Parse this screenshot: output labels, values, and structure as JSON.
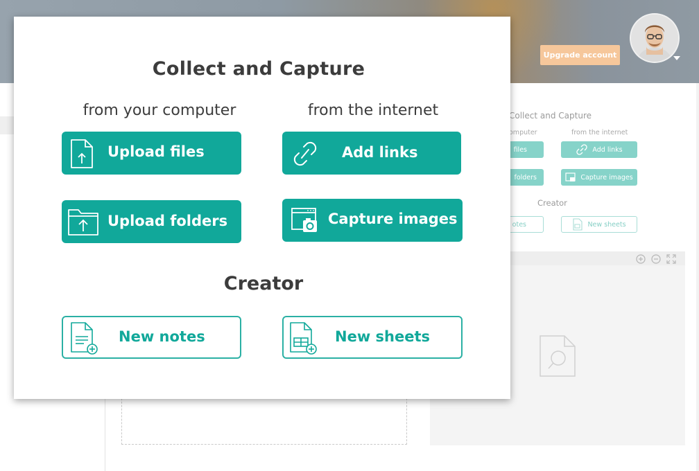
{
  "header": {
    "upgrade_label": "Upgrade account",
    "avatar_icon": "user-avatar"
  },
  "modal": {
    "title": "Collect and Capture",
    "col_computer": "from your computer",
    "col_internet": "from the internet",
    "upload_files": "Upload files",
    "add_links": "Add links",
    "upload_folders": "Upload folders",
    "capture_images": "Capture images",
    "creator_title": "Creator",
    "new_notes": "New notes",
    "new_sheets": "New sheets"
  },
  "background_panel": {
    "title": "Collect and Capture",
    "col_computer_partial": "omputer",
    "col_internet": "from the internet",
    "files_partial": "files",
    "add_links": "Add links",
    "folders_partial": "folders",
    "capture_images": "Capture images",
    "creator_title": "Creator",
    "notes_partial": "otes",
    "new_sheets": "New sheets"
  },
  "colors": {
    "accent": "#11a89a",
    "accent_light": "#86d3c9",
    "upgrade": "#f6c79b"
  }
}
